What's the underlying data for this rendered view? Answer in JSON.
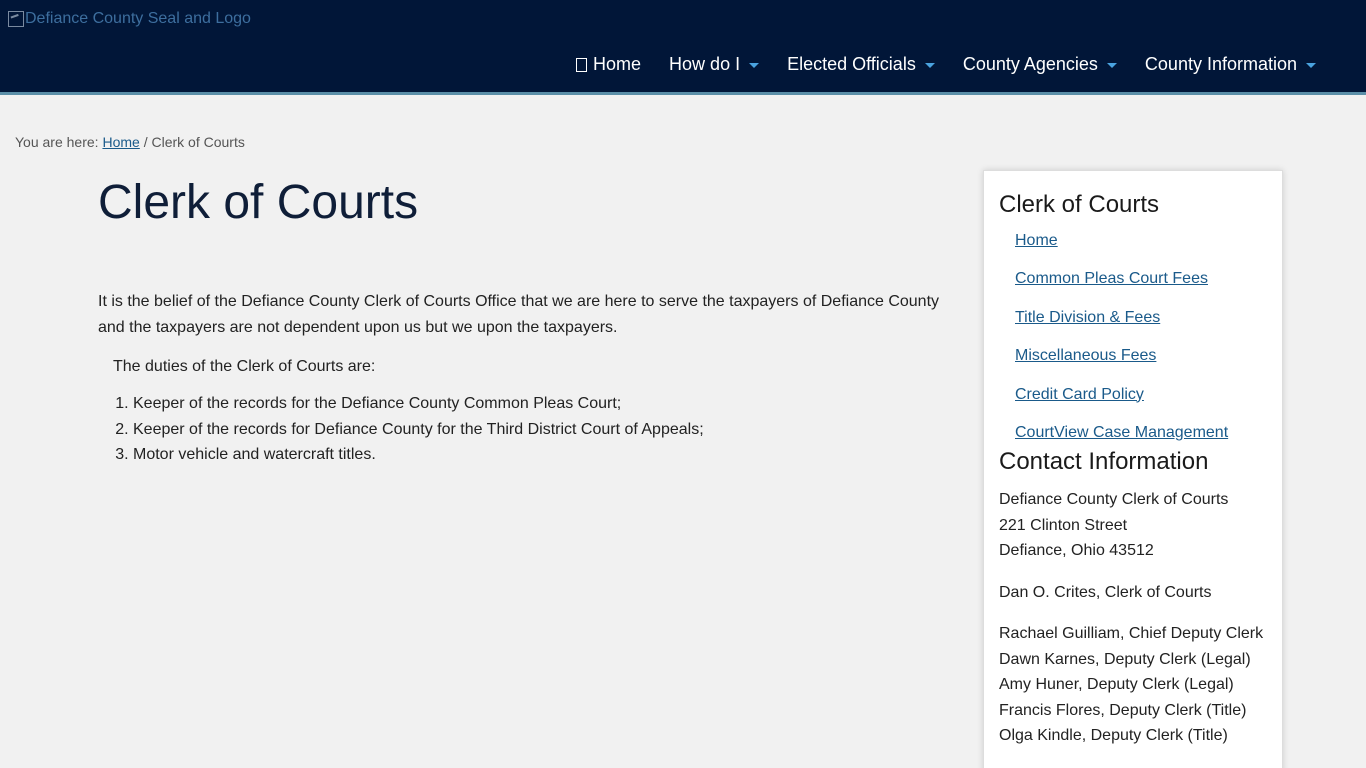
{
  "header": {
    "logo_alt": "Defiance County Seal and Logo",
    "nav": [
      {
        "label": "Home",
        "icon": "home-icon",
        "has_dropdown": false
      },
      {
        "label": "How do I",
        "has_dropdown": true
      },
      {
        "label": "Elected Officials",
        "has_dropdown": true
      },
      {
        "label": "County Agencies",
        "has_dropdown": true
      },
      {
        "label": "County Information",
        "has_dropdown": true
      }
    ]
  },
  "breadcrumb": {
    "prefix": "You are here:",
    "home": "Home",
    "separator": "/",
    "current": "Clerk of Courts"
  },
  "main": {
    "title": "Clerk of Courts",
    "intro": "It is the belief of the Defiance County Clerk of Courts Office that we are here to serve the taxpayers of Defiance County and the taxpayers are not dependent upon us but we upon the taxpayers.",
    "duties_intro": "The duties of the Clerk of Courts are:",
    "duties": [
      "Keeper of the records for the Defiance County Common Pleas Court;",
      "Keeper of the records for Defiance County for the Third District Court of Appeals;",
      "Motor vehicle and watercraft titles."
    ]
  },
  "sidebar": {
    "title": "Clerk of Courts",
    "links": [
      "Home",
      "Common Pleas Court Fees",
      "Title Division & Fees",
      "Miscellaneous Fees",
      "Credit Card Policy",
      "CourtView Case Management"
    ],
    "contact_title": "Contact Information",
    "address": [
      "Defiance County Clerk of Courts",
      "221 Clinton Street",
      "Defiance, Ohio 43512"
    ],
    "clerk": "Dan O. Crites, Clerk of Courts",
    "staff": [
      "Rachael Guilliam, Chief Deputy Clerk",
      "Dawn Karnes, Deputy Clerk (Legal)",
      "Amy Huner, Deputy Clerk (Legal)",
      "Francis Flores, Deputy Clerk (Title)",
      "Olga Kindle, Deputy Clerk (Title)"
    ]
  },
  "colors": {
    "header_bg": "#011638",
    "header_border": "#5b8fa8",
    "link": "#1a5a8a",
    "caret": "#4aa3df",
    "page_bg": "#f1f1f1"
  }
}
